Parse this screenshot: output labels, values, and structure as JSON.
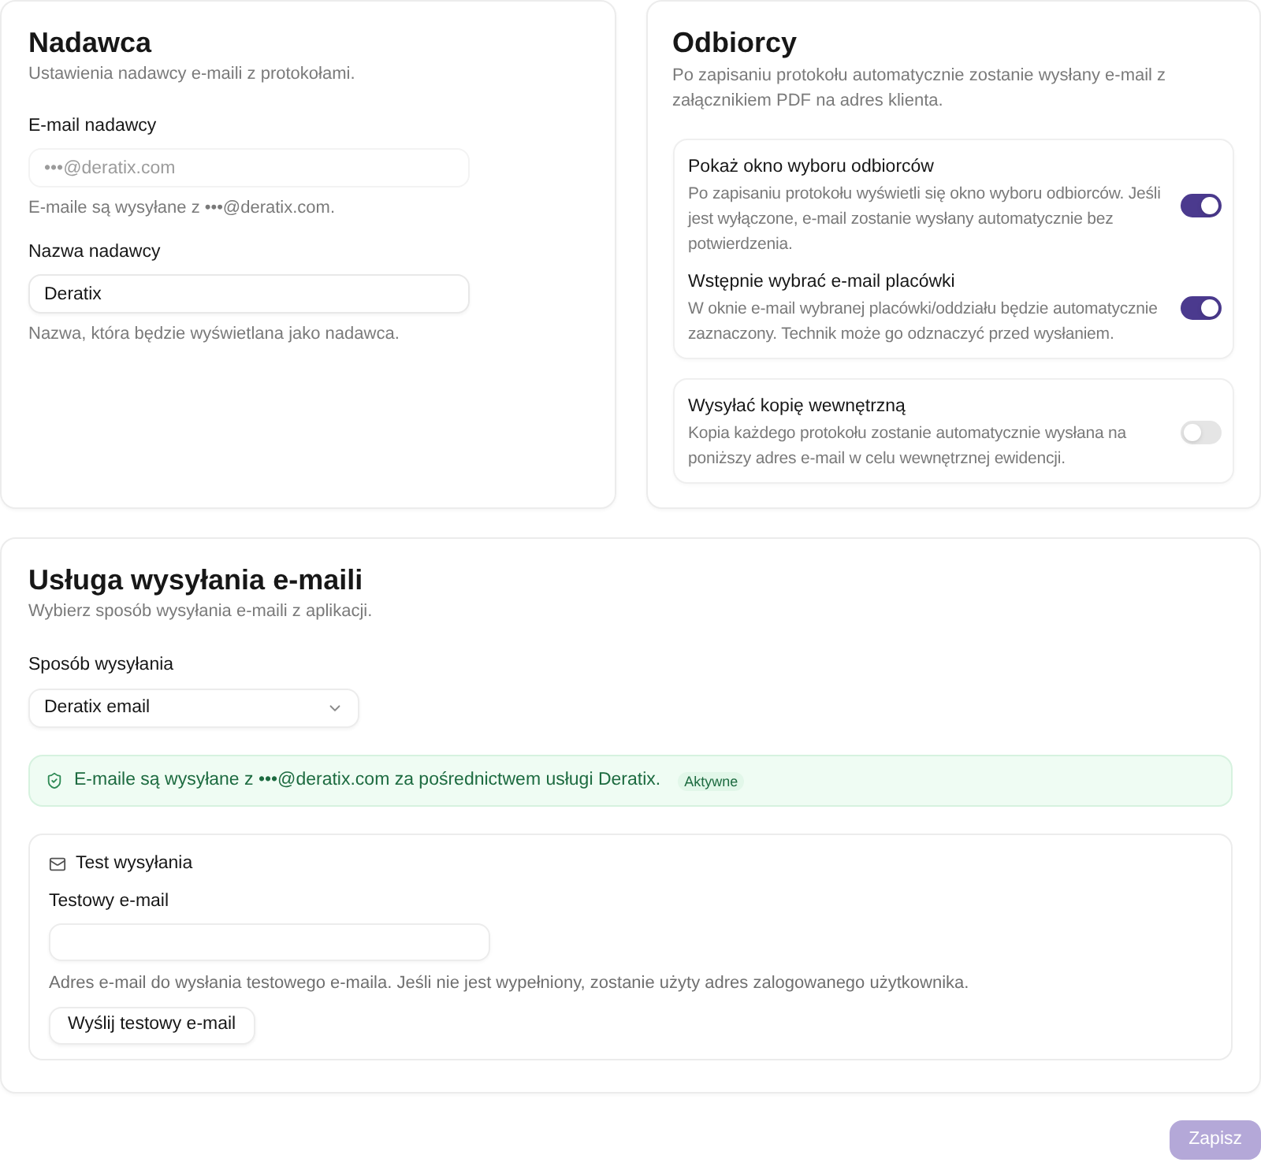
{
  "sender": {
    "title": "Nadawca",
    "description": "Ustawienia nadawcy e-maili z protokołami.",
    "fields": [
      {
        "label": "E-mail nadawcy",
        "value": "•••@deratix.com",
        "disabled": true,
        "hint": "E-maile są wysyłane z •••@deratix.com."
      },
      {
        "label": "Nazwa nadawcy",
        "value": "Deratix",
        "disabled": false,
        "hint": "Nazwa, która będzie wyświetlana jako nadawca."
      }
    ]
  },
  "recipients": {
    "title": "Odbiorcy",
    "description": "Po zapisaniu protokołu automatycznie zostanie wysłany e-mail z załącznikiem PDF na adres klienta.",
    "groups": [
      {
        "options": [
          {
            "title": "Pokaż okno wyboru odbiorców",
            "description": "Po zapisaniu protokołu wyświetli się okno wyboru odbiorców. Jeśli jest wyłączone, e-mail zostanie wysłany automatycznie bez potwierdzenia.",
            "on": true
          },
          {
            "title": "Wstępnie wybrać e-mail placówki",
            "description": "W oknie e-mail wybranej placówki/oddziału będzie automatycznie zaznaczony. Technik może go odznaczyć przed wysłaniem.",
            "on": true
          }
        ]
      },
      {
        "options": [
          {
            "title": "Wysyłać kopię wewnętrzną",
            "description": "Kopia każdego protokołu zostanie automatycznie wysłana na poniższy adres e-mail w celu wewnętrznej ewidencji.",
            "on": false
          }
        ]
      }
    ]
  },
  "service": {
    "title": "Usługa wysyłania e-maili",
    "description": "Wybierz sposób wysyłania e-maili z aplikacji.",
    "method": {
      "label": "Sposób wysyłania",
      "value": "Deratix email"
    },
    "status": {
      "text": "E-maile są wysyłane z •••@deratix.com za pośrednictwem usługi Deratix.",
      "badge": "Aktywne"
    },
    "test": {
      "title": "Test wysyłania",
      "field": {
        "label": "Testowy e-mail",
        "hint": "Adres e-mail do wysłania testowego e-maila. Jeśli nie jest wypełniony, zostanie użyty adres zalogowanego użytkownika."
      },
      "button": "Wyślij testowy e-mail"
    }
  },
  "save_button": {
    "label": "Zapisz",
    "disabled": true
  }
}
